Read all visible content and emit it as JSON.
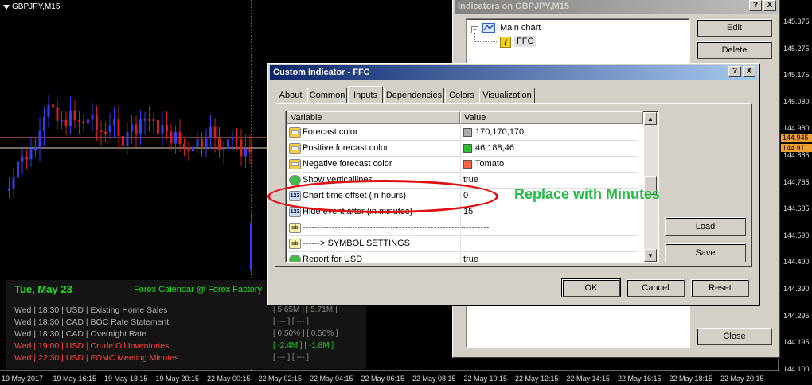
{
  "chart": {
    "symbol": "GBPJPY,M15",
    "prices": [
      "145.375",
      "145.275",
      "145.175",
      "145.080",
      "144.980",
      "144.885",
      "144.785",
      "144.685",
      "144.590",
      "144.490",
      "144.390",
      "144.295",
      "144.195",
      "144.100"
    ],
    "price_current_1": "144.945",
    "price_current_2": "144.911",
    "times": [
      "19 May 2017",
      "19 May 16:15",
      "19 May 18:15",
      "19 May 20:15",
      "22 May 00:15",
      "22 May 02:15",
      "22 May 04:15",
      "22 May 06:15",
      "22 May 08:15",
      "22 May 10:15",
      "22 May 12:15",
      "22 May 14:15",
      "22 May 16:15",
      "22 May 18:15",
      "22 May 20:15"
    ],
    "colors": {
      "bull": "#3a3af0",
      "bear": "#d02020",
      "grid": "#c8b280",
      "level": "#ff8060"
    }
  },
  "ffc": {
    "date": "Tue, May 23",
    "calendar_title": "Forex Calendar @ Forex Factory",
    "events": [
      {
        "text": "Wed | 18:30 | USD | Existing Home Sales",
        "val": "[ 5.65M ]  [ 5.71M ]",
        "red": false,
        "grn": false
      },
      {
        "text": "Wed | 18:30 | CAD | BOC Rate Statement",
        "val": "[ --- ]    [ --- ]",
        "red": false,
        "grn": false
      },
      {
        "text": "Wed | 18:30 | CAD | Overnight Rate",
        "val": "[ 0.50% ]  [ 0.50% ]",
        "red": false,
        "grn": false
      },
      {
        "text": "Wed | 19:00 | USD | Crude Oil Inventories",
        "val": "[ -2.4M ]  [ -1.8M ]",
        "red": true,
        "grn": true
      },
      {
        "text": "Wed | 22:30 | USD | FOMC Meeting Minutes",
        "val": "[ --- ]    [ --- ]",
        "red": true,
        "grn": false
      }
    ]
  },
  "indicators_window": {
    "title": "Indicators on GBPJPY,M15",
    "tree_root": "Main chart",
    "tree_child": "FFC",
    "edit": "Edit",
    "delete": "Delete",
    "close": "Close",
    "help": "?",
    "x": "X"
  },
  "dialog": {
    "title": "Custom Indicator - FFC",
    "help": "?",
    "x": "X",
    "tabs": [
      "About",
      "Common",
      "Inputs",
      "Dependencies",
      "Colors",
      "Visualization"
    ],
    "col_variable": "Variable",
    "col_value": "Value",
    "rows": [
      {
        "icon": "color",
        "name": "Forecast color",
        "value": "170,170,170",
        "swatch": "#aaaaaa"
      },
      {
        "icon": "color",
        "name": "Positive forecast color",
        "value": "46,188,46",
        "swatch": "#2ebc2e"
      },
      {
        "icon": "color",
        "name": "Negative forecast color",
        "value": "Tomato",
        "swatch": "#ff6347"
      },
      {
        "icon": "bool",
        "name": "Show verticallines",
        "value": "true",
        "swatch": ""
      },
      {
        "icon": "123",
        "name": "Chart time offset (in hours)",
        "value": "0",
        "swatch": ""
      },
      {
        "icon": "123",
        "name": "Hide event after (in minutes)",
        "value": "15",
        "swatch": ""
      },
      {
        "icon": "ab",
        "name": "----------------------------------------------------------------",
        "value": "",
        "swatch": ""
      },
      {
        "icon": "ab",
        "name": "------> SYMBOL SETTINGS",
        "value": "",
        "swatch": ""
      },
      {
        "icon": "bool",
        "name": "Report for USD",
        "value": "true",
        "swatch": ""
      }
    ],
    "load": "Load",
    "save": "Save",
    "ok": "OK",
    "cancel": "Cancel",
    "reset": "Reset"
  },
  "annotation": "Replace with Minutes"
}
